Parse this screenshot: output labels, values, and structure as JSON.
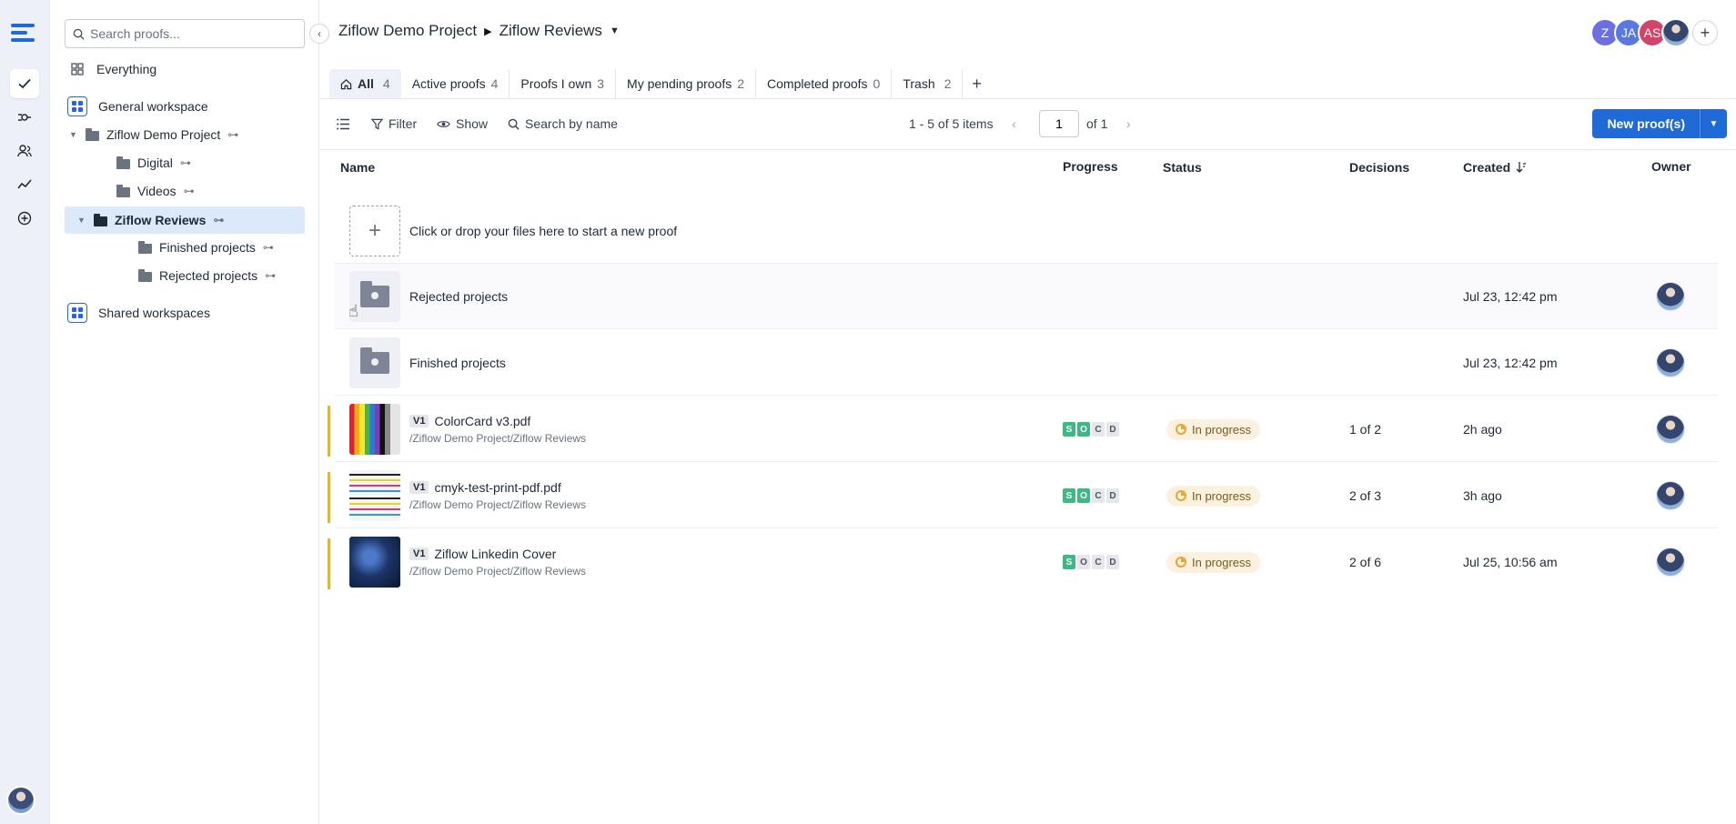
{
  "sidebar": {
    "search_placeholder": "Search proofs...",
    "everything": "Everything",
    "general_workspace": "General workspace",
    "shared_workspaces": "Shared workspaces",
    "tree": [
      {
        "label": "Ziflow Demo Project"
      },
      {
        "label": "Digital"
      },
      {
        "label": "Videos"
      },
      {
        "label": "Ziflow Reviews"
      },
      {
        "label": "Finished projects"
      },
      {
        "label": "Rejected projects"
      }
    ]
  },
  "header": {
    "breadcrumb_root": "Ziflow Demo Project",
    "breadcrumb_current": "Ziflow Reviews",
    "avatars": [
      {
        "initials": "Z",
        "color": "#6c6fe0"
      },
      {
        "initials": "JA",
        "color": "#5a79e0"
      },
      {
        "initials": "AS",
        "color": "#d2456b"
      }
    ]
  },
  "tabs": [
    {
      "label": "All",
      "count": "4"
    },
    {
      "label": "Active proofs",
      "count": "4"
    },
    {
      "label": "Proofs I own",
      "count": "3"
    },
    {
      "label": "My pending proofs",
      "count": "2"
    },
    {
      "label": "Completed proofs",
      "count": "0"
    },
    {
      "label": "Trash",
      "count": "2"
    }
  ],
  "toolbar": {
    "filter": "Filter",
    "show": "Show",
    "search_by_name": "Search by name",
    "items_range": "1 - 5 of 5 items",
    "page": "1",
    "of_pages": "of 1",
    "new_proof": "New proof(s)"
  },
  "columns": {
    "name": "Name",
    "progress": "Progress",
    "status": "Status",
    "decisions": "Decisions",
    "created": "Created",
    "owner": "Owner"
  },
  "drop_zone_text": "Click or drop your files here to start a new proof",
  "folders": [
    {
      "name": "Rejected projects",
      "created": "Jul 23, 12:42 pm"
    },
    {
      "name": "Finished projects",
      "created": "Jul 23, 12:42 pm"
    }
  ],
  "proofs": [
    {
      "version": "V1",
      "name": "ColorCard v3.pdf",
      "path": "/Ziflow Demo Project/Ziflow Reviews",
      "status": "In progress",
      "decisions": "1 of 2",
      "created": "2h ago",
      "stages_done": 2
    },
    {
      "version": "V1",
      "name": "cmyk-test-print-pdf.pdf",
      "path": "/Ziflow Demo Project/Ziflow Reviews",
      "status": "In progress",
      "decisions": "2 of 3",
      "created": "3h ago",
      "stages_done": 2
    },
    {
      "version": "V1",
      "name": "Ziflow Linkedin Cover",
      "path": "/Ziflow Demo Project/Ziflow Reviews",
      "status": "In progress",
      "decisions": "2 of 6",
      "created": "Jul 25, 10:56 am",
      "stages_done": 1
    }
  ],
  "stage_letters": [
    "S",
    "O",
    "C",
    "D"
  ],
  "colors": {
    "accent": "#1f6ad6",
    "stage_done": "#3fb885",
    "in_progress_bg": "#fbf1de",
    "row_accent": "#e8b523"
  }
}
